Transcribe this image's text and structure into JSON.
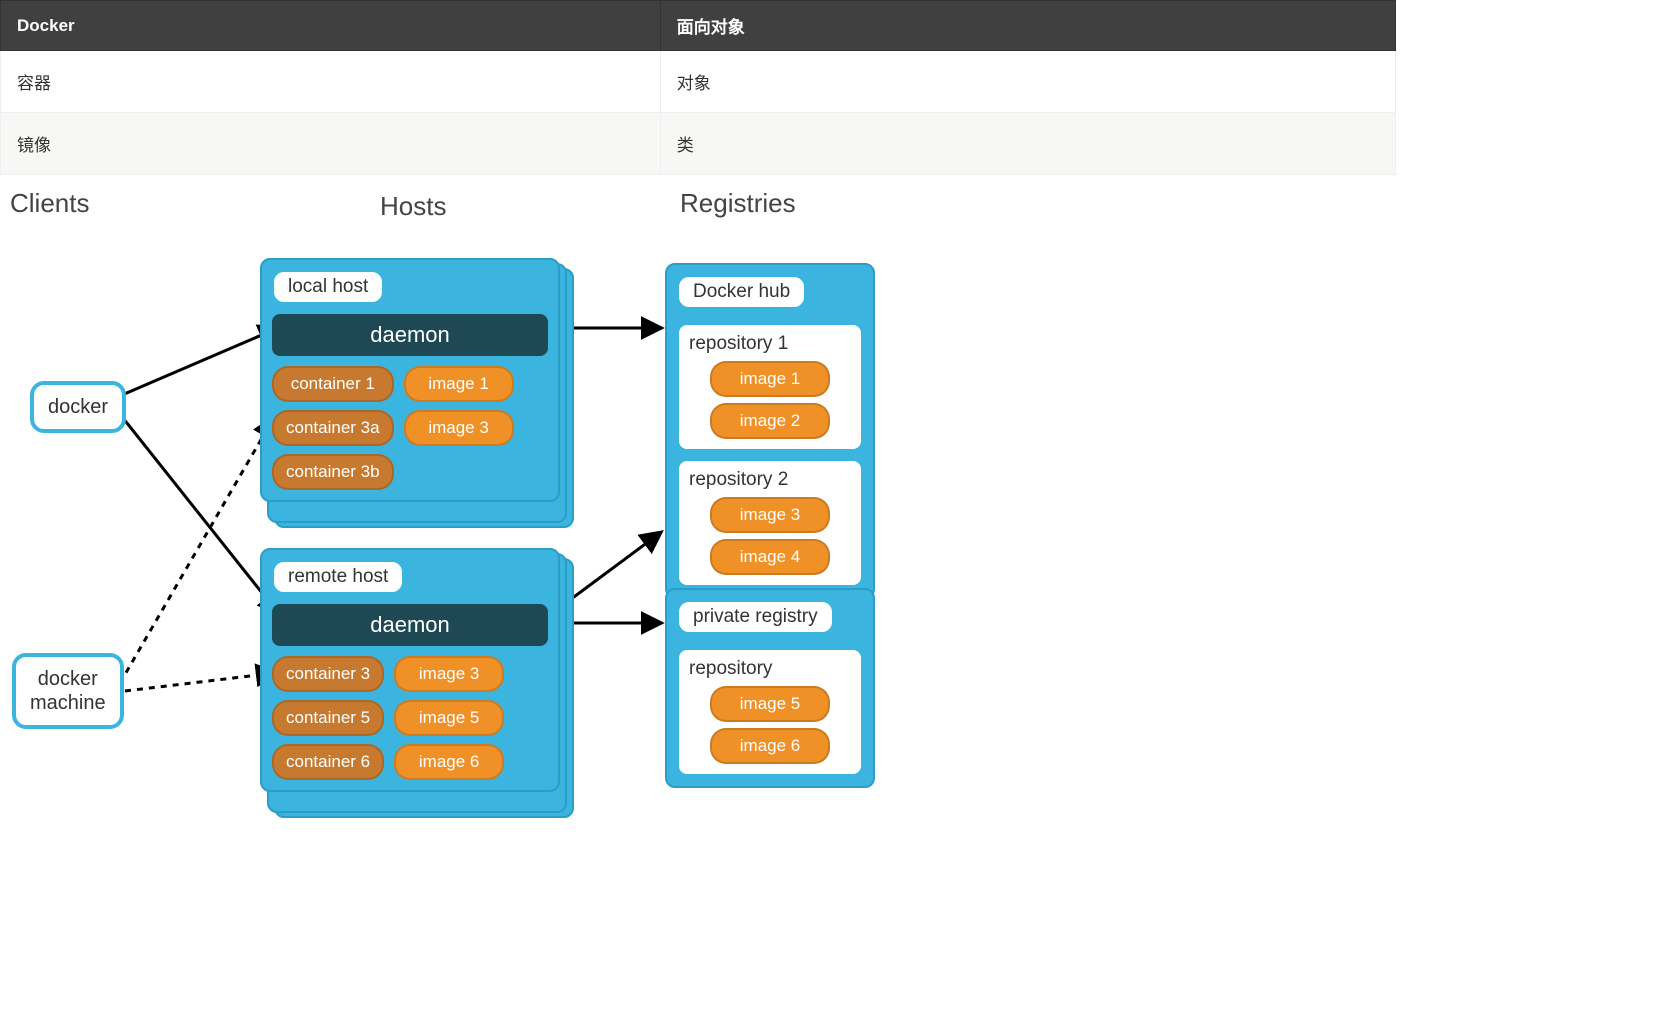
{
  "table": {
    "headers": [
      "Docker",
      "面向对象"
    ],
    "rows": [
      [
        "容器",
        "对象"
      ],
      [
        "镜像",
        "类"
      ]
    ]
  },
  "headings": {
    "clients": "Clients",
    "hosts": "Hosts",
    "registries": "Registries"
  },
  "clients": {
    "docker": "docker",
    "machine": "docker\nmachine"
  },
  "hosts": {
    "local": {
      "label": "local host",
      "daemon": "daemon",
      "containers": [
        "container 1",
        "container 3a",
        "container 3b"
      ],
      "images": [
        "image 1",
        "image 3"
      ]
    },
    "remote": {
      "label": "remote host",
      "daemon": "daemon",
      "containers": [
        "container 3",
        "container 5",
        "container 6"
      ],
      "images": [
        "image 3",
        "image 5",
        "image 6"
      ]
    }
  },
  "registries": {
    "hub": {
      "label": "Docker hub",
      "repos": [
        {
          "name": "repository 1",
          "images": [
            "image 1",
            "image 2"
          ]
        },
        {
          "name": "repository 2",
          "images": [
            "image 3",
            "image 4"
          ]
        }
      ]
    },
    "private": {
      "label": "private registry",
      "repos": [
        {
          "name": "repository",
          "images": [
            "image 5",
            "image 6"
          ]
        }
      ]
    }
  }
}
